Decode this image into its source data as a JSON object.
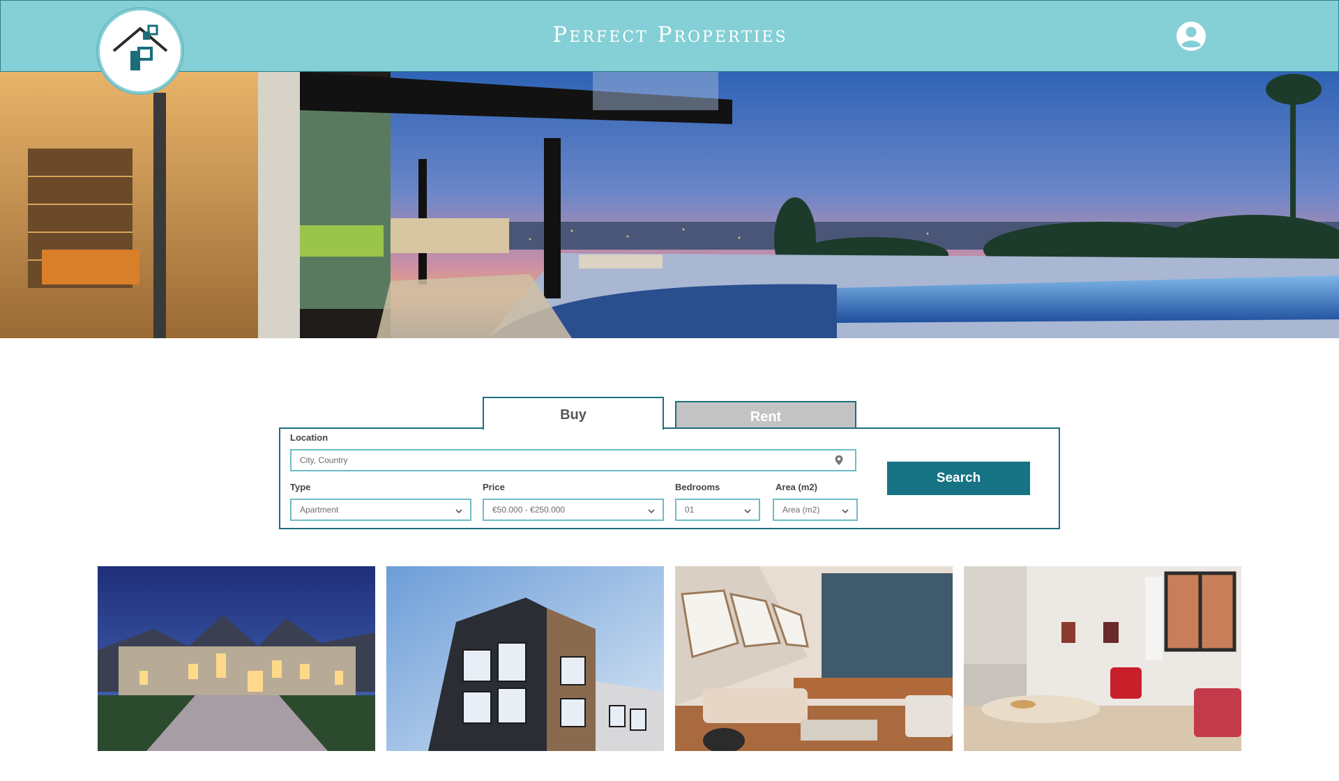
{
  "header": {
    "title": "Perfect Properties",
    "logo_icon": "house-logo-icon",
    "profile_icon": "user-circle-icon",
    "bg_color": "#85cfd6"
  },
  "hero": {
    "image": "luxury-villa-infinity-pool-sunset"
  },
  "search": {
    "tabs": [
      {
        "label": "Buy",
        "active": true
      },
      {
        "label": "Rent",
        "active": false
      }
    ],
    "location_label": "Location",
    "location_placeholder": "City, Country",
    "type_label": "Type",
    "type_value": "Apartment",
    "price_label": "Price",
    "price_value": "€50.000 - €250.000",
    "bedrooms_label": "Bedrooms",
    "bedrooms_value": "01",
    "area_label": "Area (m2)",
    "area_value": "Area (m2)",
    "search_button": "Search",
    "accent_color": "#157383"
  },
  "listings": [
    {
      "image": "manor-house-at-dusk"
    },
    {
      "image": "modern-apartment-building"
    },
    {
      "image": "attic-living-room"
    },
    {
      "image": "bright-apartment-dining"
    }
  ]
}
